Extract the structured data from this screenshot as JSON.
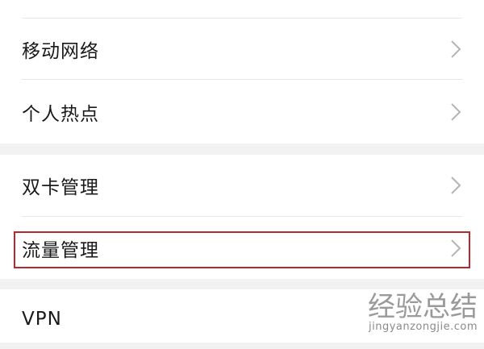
{
  "settings": {
    "items": [
      {
        "label": "移动网络"
      },
      {
        "label": "个人热点"
      },
      {
        "label": "双卡管理"
      },
      {
        "label": "流量管理"
      },
      {
        "label": "VPN"
      }
    ]
  },
  "icons": {
    "chevron": "chevron-right-icon"
  },
  "colors": {
    "highlight": "#b22a2e",
    "background": "#f2f2f2"
  },
  "watermark": {
    "logo": "经验总结",
    "site": "jingyanzongjie.com"
  }
}
